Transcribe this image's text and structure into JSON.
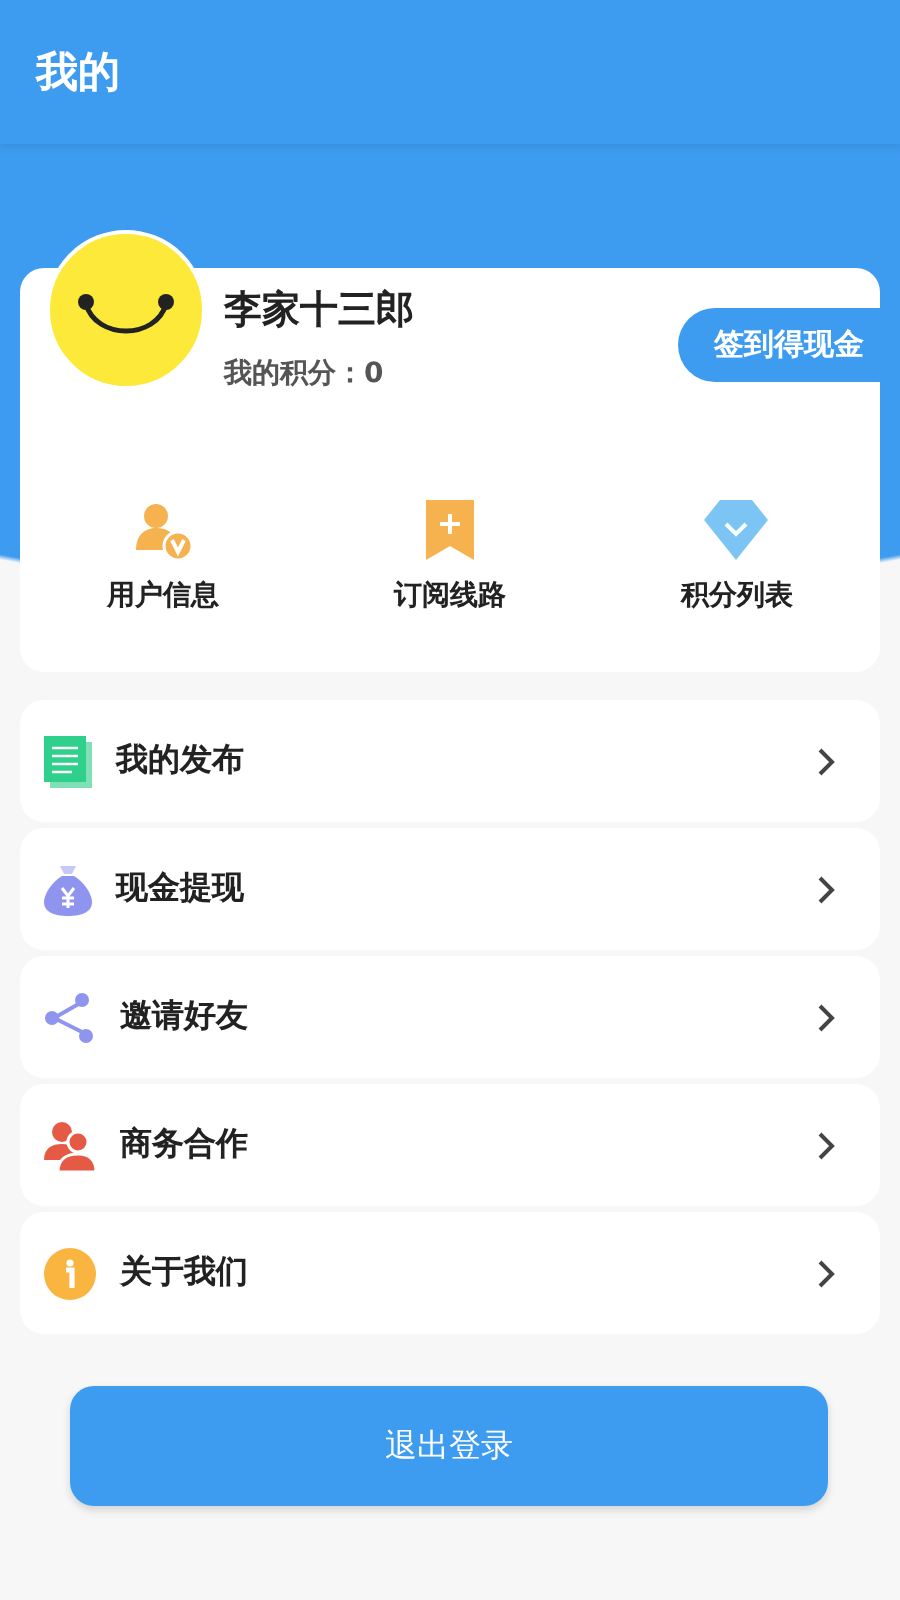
{
  "header": {
    "title": "我的"
  },
  "profile": {
    "name": "李家十三郎",
    "points": "我的积分：0",
    "sign_button": "签到得现金"
  },
  "shortcuts": [
    {
      "label": "用户信息"
    },
    {
      "label": "订阅线路"
    },
    {
      "label": "积分列表"
    }
  ],
  "menu": [
    {
      "label": "我的发布"
    },
    {
      "label": "现金提现"
    },
    {
      "label": "邀请好友"
    },
    {
      "label": "商务合作"
    },
    {
      "label": "关于我们"
    }
  ],
  "logout_button": "退出登录"
}
